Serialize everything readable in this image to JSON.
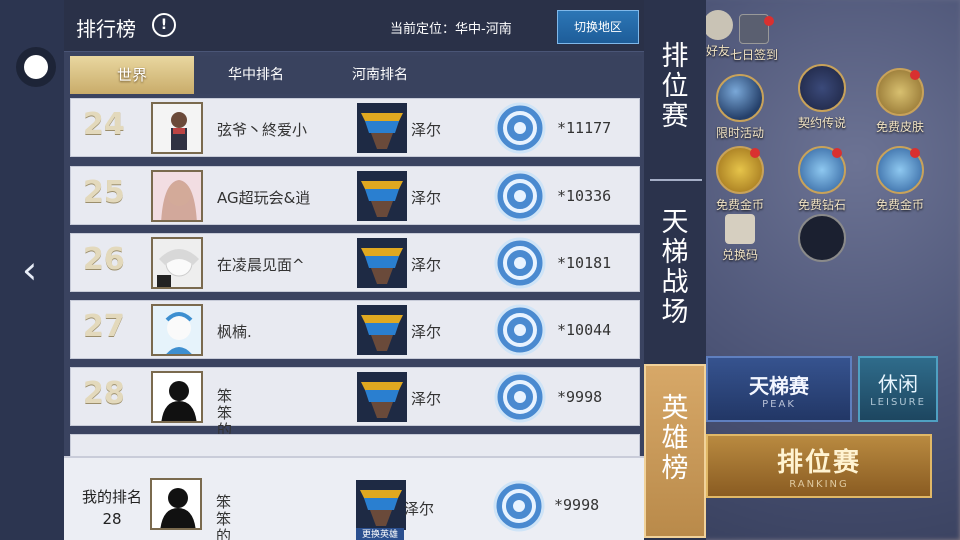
{
  "panel": {
    "title": "排行榜",
    "info_icon": "exclamation-icon",
    "location_text": "当前定位：华中-河南",
    "switch_region_label": "切换地区"
  },
  "tabs": [
    {
      "label": "世界",
      "active": true
    },
    {
      "label": "华中排名",
      "active": false
    },
    {
      "label": "河南排名",
      "active": false
    }
  ],
  "rows": [
    {
      "rank": "24",
      "nickname": "弦爷丶終爱小",
      "hero": "泽尔",
      "score": "*11177"
    },
    {
      "rank": "25",
      "nickname": "AG超玩会&逍",
      "hero": "泽尔",
      "score": "*10336"
    },
    {
      "rank": "26",
      "nickname": "在凌晨见面^",
      "hero": "泽尔",
      "score": "*10181"
    },
    {
      "rank": "27",
      "nickname": "枫楠.",
      "hero": "泽尔",
      "score": "*10044"
    },
    {
      "rank": "28",
      "nickname": "笨笨的小",
      "hero": "泽尔",
      "score": "*9998"
    }
  ],
  "my_rank": {
    "label": "我的排名",
    "rank": "28",
    "nickname": "笨笨的",
    "hero": "泽尔",
    "change_hero_label": "更换英雄",
    "score": "*9998"
  },
  "side_tabs": [
    {
      "label": "排位赛",
      "active": false
    },
    {
      "label": "天梯战场",
      "active": false
    },
    {
      "label": "英雄榜",
      "active": true
    }
  ],
  "background": {
    "icons": [
      {
        "label": "好友"
      },
      {
        "label": "七日签到"
      },
      {
        "label": "限时活动"
      },
      {
        "label": "契约传说"
      },
      {
        "label": "免费皮肤"
      },
      {
        "label": "免费金币"
      },
      {
        "label": "免费钻石"
      },
      {
        "label": "免费金币"
      },
      {
        "label": "兑换码"
      }
    ],
    "modes": {
      "tianti": {
        "label": "天梯赛",
        "sub": "PEAK"
      },
      "xiuxian": {
        "label": "休闲",
        "sub": "LEISURE"
      },
      "rank": {
        "label": "排位赛",
        "sub": "RANKING"
      }
    }
  },
  "colors": {
    "panel_bg": "#3a4360",
    "row_bg": "#e8eaf1",
    "active_tab_gold": "#c9ac6a",
    "switch_button_blue": "#1e5d99",
    "side_tab_active": "#b98a4a"
  }
}
